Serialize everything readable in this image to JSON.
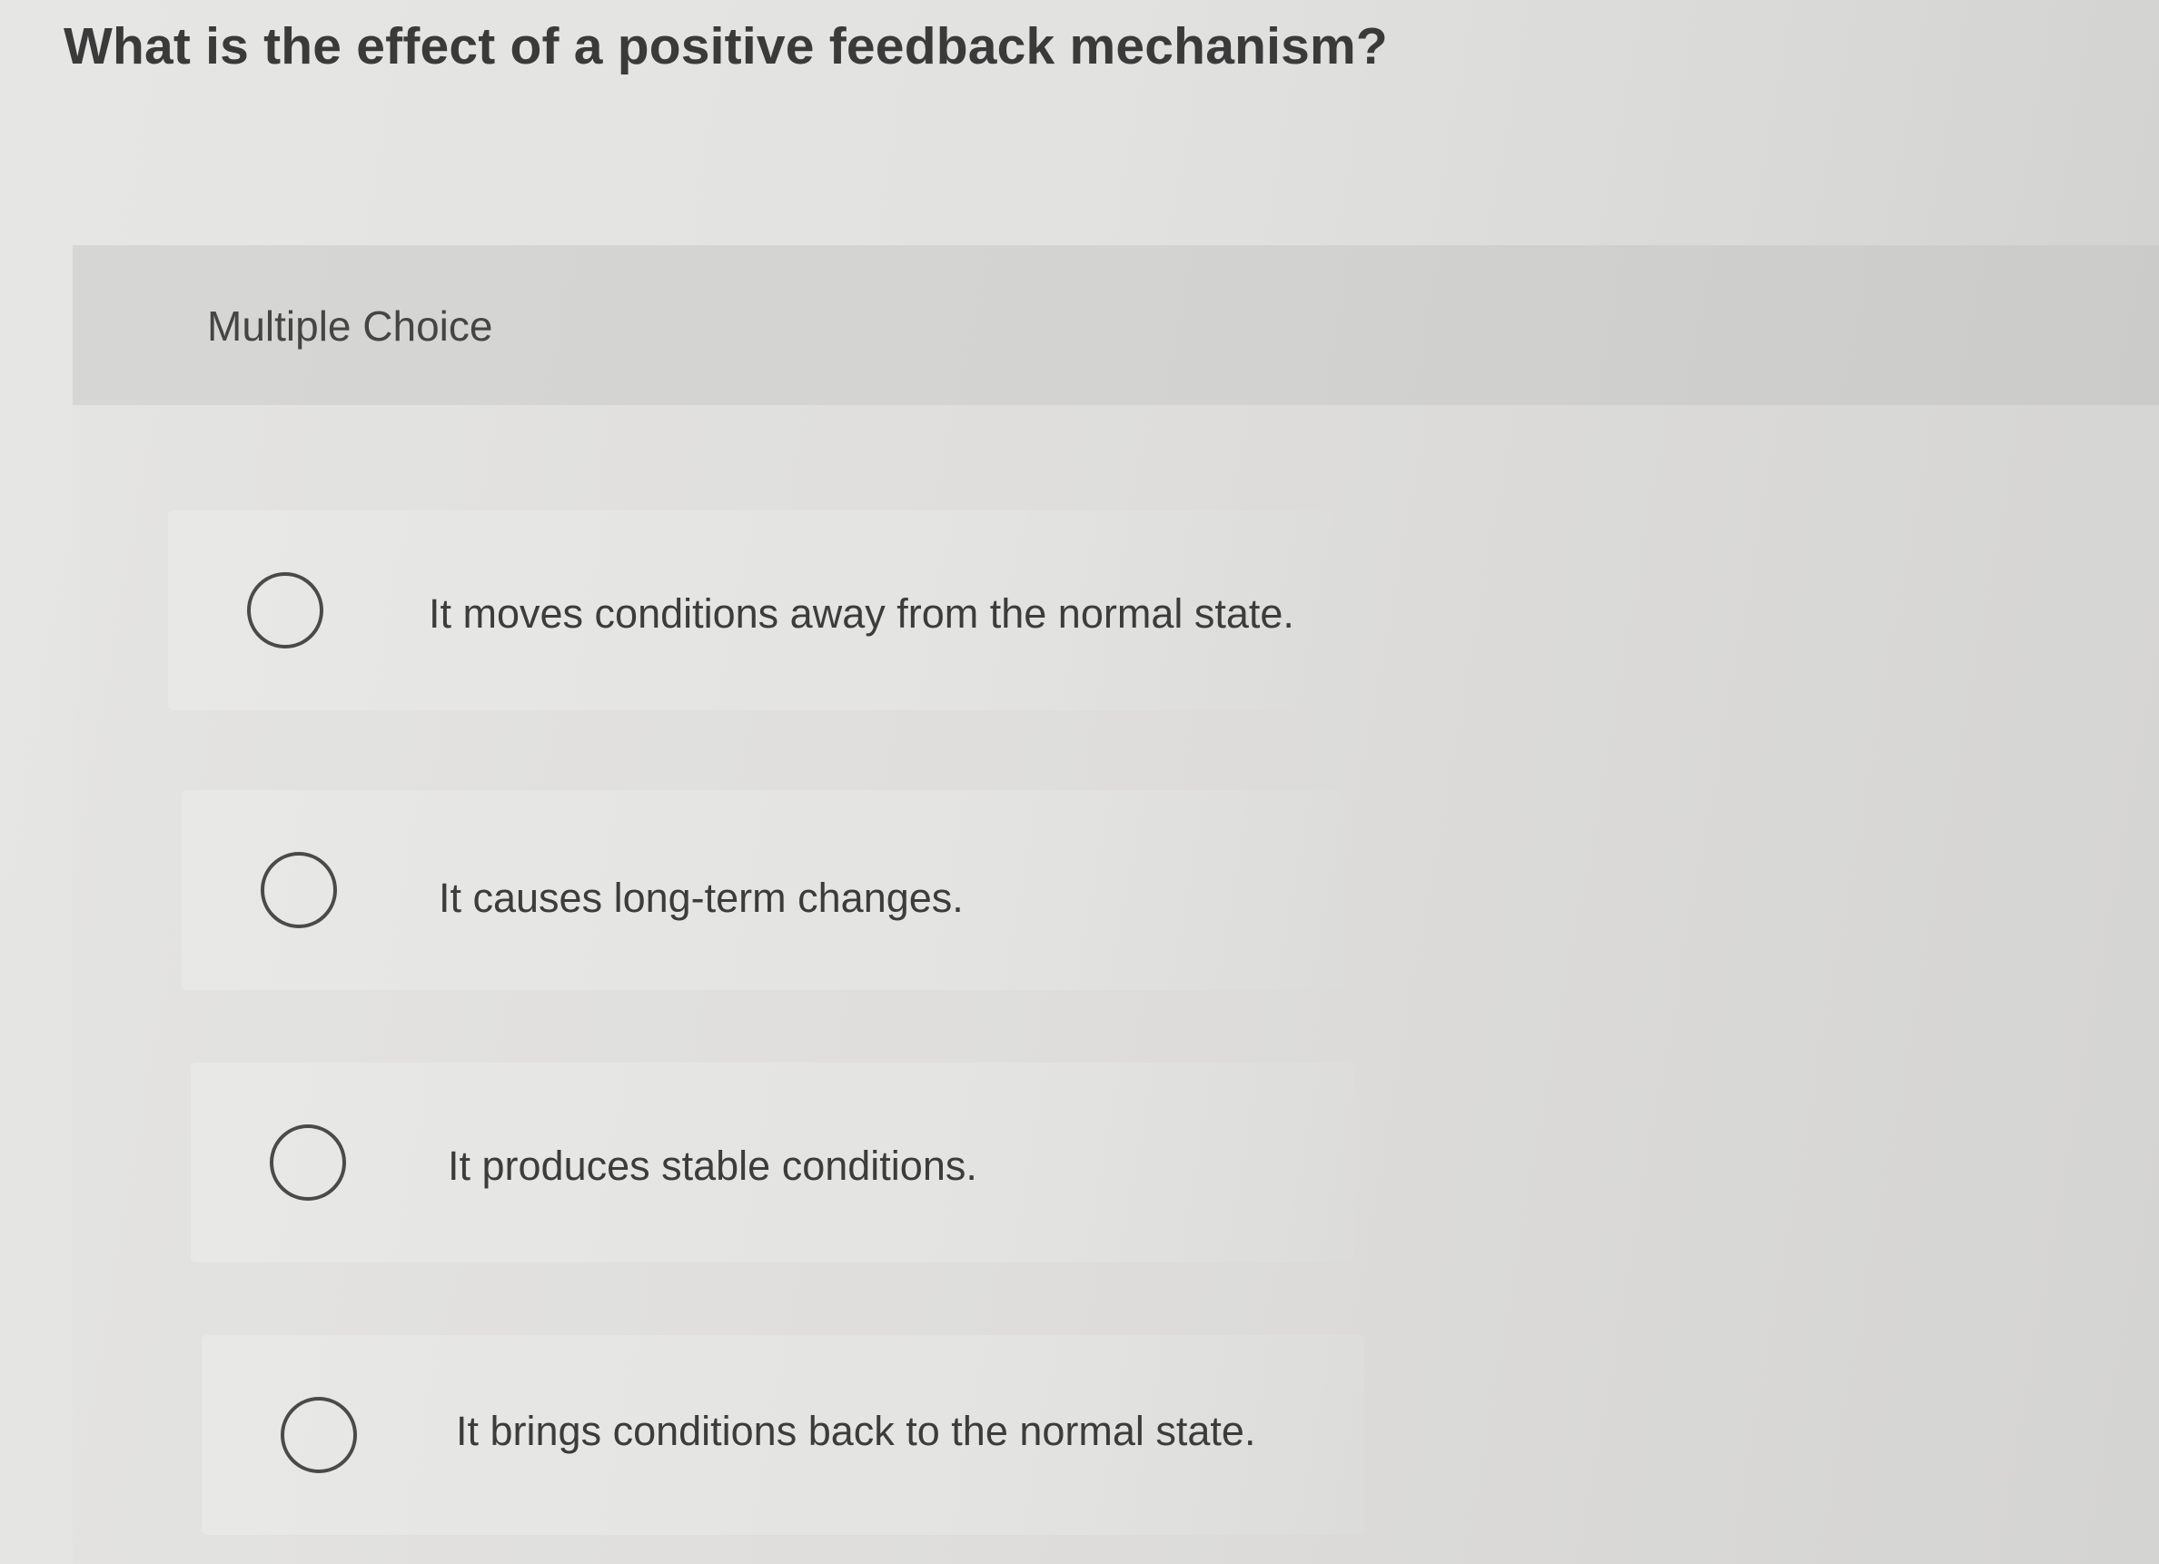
{
  "question": {
    "text": "What is the effect of a positive feedback mechanism?"
  },
  "panel": {
    "header_label": "Multiple Choice"
  },
  "choices": [
    {
      "label": "It moves conditions away from the normal state.",
      "selected": false
    },
    {
      "label": "It causes long-term changes.",
      "selected": false
    },
    {
      "label": "It produces stable conditions.",
      "selected": false
    },
    {
      "label": "It brings conditions back to the normal state.",
      "selected": false
    }
  ]
}
